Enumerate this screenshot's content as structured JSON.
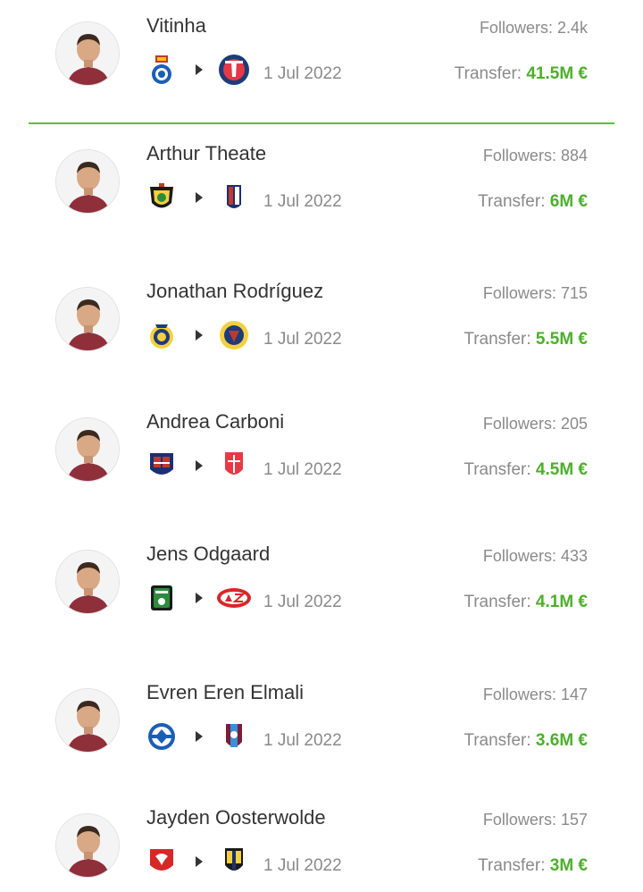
{
  "labels": {
    "followers_prefix": "Followers: ",
    "transfer_prefix": "Transfer: "
  },
  "colors": {
    "accent": "#4caf2a",
    "divider": "#5bbf3a",
    "muted_text": "#8a8a8a",
    "primary_text": "#333333"
  },
  "transfers": [
    {
      "name": "Vitinha",
      "followers": "2.4k",
      "date": "1 Jul 2022",
      "fee": "41.5M €",
      "from_club_icon": "fc-porto-crest-icon",
      "to_club_icon": "psg-crest-icon"
    },
    {
      "name": "Arthur Theate",
      "followers": "884",
      "date": "1 Jul 2022",
      "fee": "6M €",
      "from_club_icon": "ostende-crest-icon",
      "to_club_icon": "bologna-crest-icon"
    },
    {
      "name": "Jonathan Rodríguez",
      "followers": "715",
      "date": "1 Jul 2022",
      "fee": "5.5M €",
      "from_club_icon": "al-nassr-crest-icon",
      "to_club_icon": "club-america-crest-icon"
    },
    {
      "name": "Andrea Carboni",
      "followers": "205",
      "date": "1 Jul 2022",
      "fee": "4.5M €",
      "from_club_icon": "cagliari-crest-icon",
      "to_club_icon": "monza-crest-icon"
    },
    {
      "name": "Jens Odgaard",
      "followers": "433",
      "date": "1 Jul 2022",
      "fee": "4.1M €",
      "from_club_icon": "sassuolo-crest-icon",
      "to_club_icon": "az-alkmaar-crest-icon"
    },
    {
      "name": "Evren Eren Elmali",
      "followers": "147",
      "date": "1 Jul 2022",
      "fee": "3.6M €",
      "from_club_icon": "kasimpasa-crest-icon",
      "to_club_icon": "trabzonspor-crest-icon"
    },
    {
      "name": "Jayden Oosterwolde",
      "followers": "157",
      "date": "1 Jul 2022",
      "fee": "3M €",
      "from_club_icon": "twente-crest-icon",
      "to_club_icon": "parma-crest-icon"
    }
  ]
}
